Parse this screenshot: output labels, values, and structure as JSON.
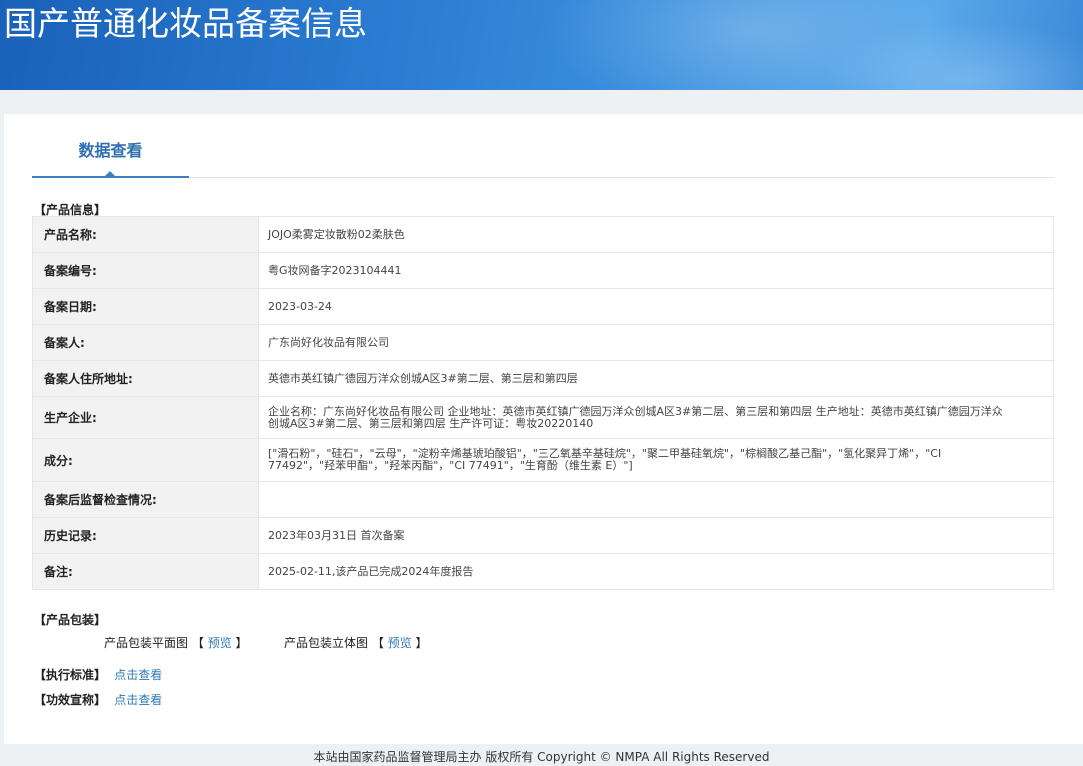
{
  "banner": {
    "title": "国产普通化妆品备案信息"
  },
  "tabs": [
    {
      "label": "数据查看",
      "active": true
    }
  ],
  "product_info": {
    "section_label": "【产品信息】",
    "rows": [
      {
        "key": "产品名称:",
        "value": "JOJO柔雾定妆散粉02柔肤色"
      },
      {
        "key": "备案编号:",
        "value": "粤G妆网备字2023104441"
      },
      {
        "key": "备案日期:",
        "value": "2023-03-24"
      },
      {
        "key": "备案人:",
        "value": "广东尚好化妆品有限公司"
      },
      {
        "key": "备案人住所地址:",
        "value": "英德市英红镇广德园万洋众创城A区3#第二层、第三层和第四层"
      },
      {
        "key": "生产企业:",
        "value": "企业名称：广东尚好化妆品有限公司 企业地址：英德市英红镇广德园万洋众创城A区3#第二层、第三层和第四层 生产地址：英德市英红镇广德园万洋众创城A区3#第二层、第三层和第四层 生产许可证：粤妆20220140"
      },
      {
        "key": "成分:",
        "value": "[\"滑石粉\"，\"硅石\"，\"云母\"，\"淀粉辛烯基琥珀酸铝\"，\"三乙氧基辛基硅烷\"，\"聚二甲基硅氧烷\"，\"棕榈酸乙基己酯\"，\"氢化聚异丁烯\"，\"CI 77492\"，\"羟苯甲酯\"，\"羟苯丙酯\"，\"CI 77491\"，\"生育酚（维生素 E）\"]"
      },
      {
        "key": "备案后监督检查情况:",
        "value": ""
      },
      {
        "key": "历史记录:",
        "value": "2023年03月31日 首次备案"
      },
      {
        "key": "备注:",
        "value": "2025-02-11,该产品已完成2024年度报告"
      }
    ]
  },
  "packaging": {
    "section_label": "【产品包装】",
    "flat_label": "产品包装平面图",
    "stereo_label": "产品包装立体图",
    "bracket_open": "【",
    "bracket_close": "】",
    "preview_link": "预览"
  },
  "standard": {
    "section_label": "【执行标准】",
    "link": "点击查看"
  },
  "efficacy": {
    "section_label": "【功效宣称】",
    "link": "点击查看"
  },
  "footer": {
    "text": "本站由国家药品监督管理局主办 版权所有 Copyright © NMPA All Rights Reserved"
  }
}
